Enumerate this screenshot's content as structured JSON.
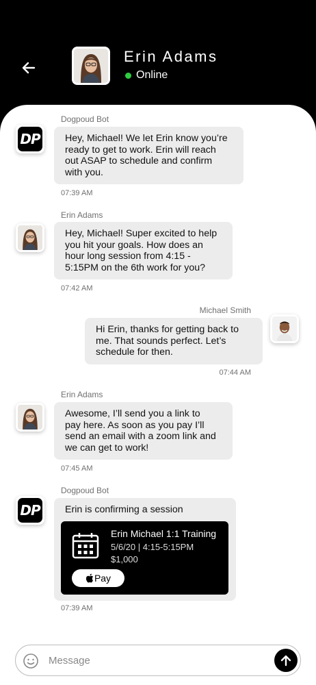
{
  "header": {
    "contact_name": "Erin Adams",
    "status": "Online",
    "status_color": "#2ecc40"
  },
  "messages": [
    {
      "sender": "Dogpoud Bot",
      "avatar": "dp-logo",
      "lines": [
        "Hey, Michael! We let Erin know you’re",
        "ready to get to work. Erin will reach",
        "out ASAP to schedule and confirm",
        "with you."
      ],
      "time": "07:39 AM"
    },
    {
      "sender": "Erin Adams",
      "avatar": "erin-avatar",
      "lines": [
        "Hey, Michael! Super excited to help",
        "you hit your goals. How does an",
        "hour long session from 4:15 -",
        "5:15PM on the 6th work for you?"
      ],
      "time": "07:42 AM"
    },
    {
      "sender": "Michael Smith",
      "avatar": "michael-avatar",
      "lines": [
        "Hi Erin, thanks for getting back to",
        "me. That sounds perfect. Let’s",
        "schedule for then."
      ],
      "time": "07:44 AM"
    },
    {
      "sender": "Erin Adams",
      "avatar": "erin-avatar",
      "lines": [
        "Awesome, I’ll send you a link to",
        "pay here. As soon as you pay I’ll",
        "send an email with a zoom link and",
        "we can get to work!"
      ],
      "time": "07:45 AM"
    },
    {
      "sender": "Dogpoud Bot",
      "avatar": "dp-logo",
      "lines": [
        "Erin is confirming a session"
      ],
      "time": "07:39 AM"
    }
  ],
  "session_card": {
    "title": "Erin Michael 1:1 Training",
    "datetime": "5/6/20 | 4:15-5:15PM",
    "price": "$1,000",
    "pay_label": "Pay",
    "icon": "calendar-icon"
  },
  "bot_logo_text": "DP",
  "composer": {
    "placeholder": "Message",
    "emoji_icon": "emoji-icon",
    "send_icon": "send-arrow-icon"
  }
}
